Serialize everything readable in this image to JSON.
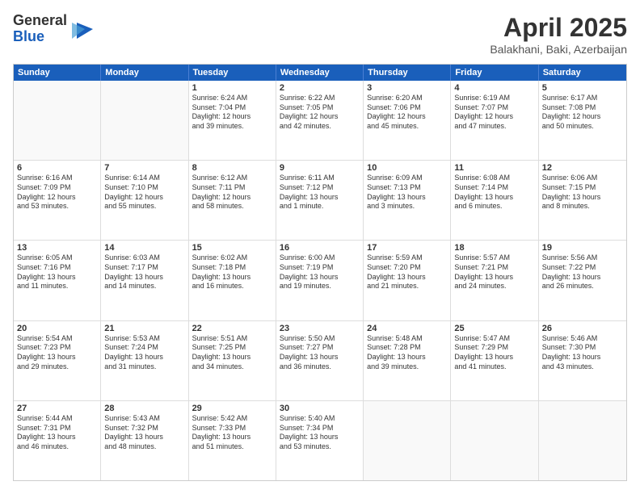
{
  "logo": {
    "general": "General",
    "blue": "Blue"
  },
  "title": "April 2025",
  "location": "Balakhani, Baki, Azerbaijan",
  "header_days": [
    "Sunday",
    "Monday",
    "Tuesday",
    "Wednesday",
    "Thursday",
    "Friday",
    "Saturday"
  ],
  "rows": [
    [
      {
        "day": "",
        "lines": []
      },
      {
        "day": "",
        "lines": []
      },
      {
        "day": "1",
        "lines": [
          "Sunrise: 6:24 AM",
          "Sunset: 7:04 PM",
          "Daylight: 12 hours",
          "and 39 minutes."
        ]
      },
      {
        "day": "2",
        "lines": [
          "Sunrise: 6:22 AM",
          "Sunset: 7:05 PM",
          "Daylight: 12 hours",
          "and 42 minutes."
        ]
      },
      {
        "day": "3",
        "lines": [
          "Sunrise: 6:20 AM",
          "Sunset: 7:06 PM",
          "Daylight: 12 hours",
          "and 45 minutes."
        ]
      },
      {
        "day": "4",
        "lines": [
          "Sunrise: 6:19 AM",
          "Sunset: 7:07 PM",
          "Daylight: 12 hours",
          "and 47 minutes."
        ]
      },
      {
        "day": "5",
        "lines": [
          "Sunrise: 6:17 AM",
          "Sunset: 7:08 PM",
          "Daylight: 12 hours",
          "and 50 minutes."
        ]
      }
    ],
    [
      {
        "day": "6",
        "lines": [
          "Sunrise: 6:16 AM",
          "Sunset: 7:09 PM",
          "Daylight: 12 hours",
          "and 53 minutes."
        ]
      },
      {
        "day": "7",
        "lines": [
          "Sunrise: 6:14 AM",
          "Sunset: 7:10 PM",
          "Daylight: 12 hours",
          "and 55 minutes."
        ]
      },
      {
        "day": "8",
        "lines": [
          "Sunrise: 6:12 AM",
          "Sunset: 7:11 PM",
          "Daylight: 12 hours",
          "and 58 minutes."
        ]
      },
      {
        "day": "9",
        "lines": [
          "Sunrise: 6:11 AM",
          "Sunset: 7:12 PM",
          "Daylight: 13 hours",
          "and 1 minute."
        ]
      },
      {
        "day": "10",
        "lines": [
          "Sunrise: 6:09 AM",
          "Sunset: 7:13 PM",
          "Daylight: 13 hours",
          "and 3 minutes."
        ]
      },
      {
        "day": "11",
        "lines": [
          "Sunrise: 6:08 AM",
          "Sunset: 7:14 PM",
          "Daylight: 13 hours",
          "and 6 minutes."
        ]
      },
      {
        "day": "12",
        "lines": [
          "Sunrise: 6:06 AM",
          "Sunset: 7:15 PM",
          "Daylight: 13 hours",
          "and 8 minutes."
        ]
      }
    ],
    [
      {
        "day": "13",
        "lines": [
          "Sunrise: 6:05 AM",
          "Sunset: 7:16 PM",
          "Daylight: 13 hours",
          "and 11 minutes."
        ]
      },
      {
        "day": "14",
        "lines": [
          "Sunrise: 6:03 AM",
          "Sunset: 7:17 PM",
          "Daylight: 13 hours",
          "and 14 minutes."
        ]
      },
      {
        "day": "15",
        "lines": [
          "Sunrise: 6:02 AM",
          "Sunset: 7:18 PM",
          "Daylight: 13 hours",
          "and 16 minutes."
        ]
      },
      {
        "day": "16",
        "lines": [
          "Sunrise: 6:00 AM",
          "Sunset: 7:19 PM",
          "Daylight: 13 hours",
          "and 19 minutes."
        ]
      },
      {
        "day": "17",
        "lines": [
          "Sunrise: 5:59 AM",
          "Sunset: 7:20 PM",
          "Daylight: 13 hours",
          "and 21 minutes."
        ]
      },
      {
        "day": "18",
        "lines": [
          "Sunrise: 5:57 AM",
          "Sunset: 7:21 PM",
          "Daylight: 13 hours",
          "and 24 minutes."
        ]
      },
      {
        "day": "19",
        "lines": [
          "Sunrise: 5:56 AM",
          "Sunset: 7:22 PM",
          "Daylight: 13 hours",
          "and 26 minutes."
        ]
      }
    ],
    [
      {
        "day": "20",
        "lines": [
          "Sunrise: 5:54 AM",
          "Sunset: 7:23 PM",
          "Daylight: 13 hours",
          "and 29 minutes."
        ]
      },
      {
        "day": "21",
        "lines": [
          "Sunrise: 5:53 AM",
          "Sunset: 7:24 PM",
          "Daylight: 13 hours",
          "and 31 minutes."
        ]
      },
      {
        "day": "22",
        "lines": [
          "Sunrise: 5:51 AM",
          "Sunset: 7:25 PM",
          "Daylight: 13 hours",
          "and 34 minutes."
        ]
      },
      {
        "day": "23",
        "lines": [
          "Sunrise: 5:50 AM",
          "Sunset: 7:27 PM",
          "Daylight: 13 hours",
          "and 36 minutes."
        ]
      },
      {
        "day": "24",
        "lines": [
          "Sunrise: 5:48 AM",
          "Sunset: 7:28 PM",
          "Daylight: 13 hours",
          "and 39 minutes."
        ]
      },
      {
        "day": "25",
        "lines": [
          "Sunrise: 5:47 AM",
          "Sunset: 7:29 PM",
          "Daylight: 13 hours",
          "and 41 minutes."
        ]
      },
      {
        "day": "26",
        "lines": [
          "Sunrise: 5:46 AM",
          "Sunset: 7:30 PM",
          "Daylight: 13 hours",
          "and 43 minutes."
        ]
      }
    ],
    [
      {
        "day": "27",
        "lines": [
          "Sunrise: 5:44 AM",
          "Sunset: 7:31 PM",
          "Daylight: 13 hours",
          "and 46 minutes."
        ]
      },
      {
        "day": "28",
        "lines": [
          "Sunrise: 5:43 AM",
          "Sunset: 7:32 PM",
          "Daylight: 13 hours",
          "and 48 minutes."
        ]
      },
      {
        "day": "29",
        "lines": [
          "Sunrise: 5:42 AM",
          "Sunset: 7:33 PM",
          "Daylight: 13 hours",
          "and 51 minutes."
        ]
      },
      {
        "day": "30",
        "lines": [
          "Sunrise: 5:40 AM",
          "Sunset: 7:34 PM",
          "Daylight: 13 hours",
          "and 53 minutes."
        ]
      },
      {
        "day": "",
        "lines": []
      },
      {
        "day": "",
        "lines": []
      },
      {
        "day": "",
        "lines": []
      }
    ]
  ]
}
